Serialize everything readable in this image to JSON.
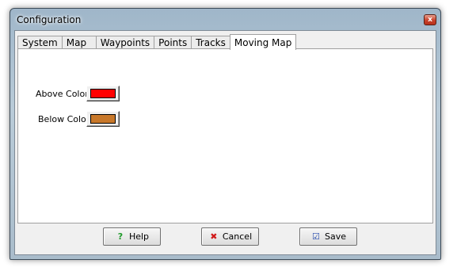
{
  "window": {
    "title": "Configuration",
    "close_label": "x"
  },
  "tabs": [
    {
      "label": "System"
    },
    {
      "label": "Map"
    },
    {
      "label": "Waypoints"
    },
    {
      "label": "Points"
    },
    {
      "label": "Tracks"
    },
    {
      "label": "Moving Map",
      "active": true
    }
  ],
  "moving_map": {
    "above_color_label": "Above Color",
    "above_color_value": "#ff0000",
    "below_color_label": "Below Color",
    "below_color_value": "#c8782a"
  },
  "buttons": {
    "help_label": "Help",
    "help_icon": "question-icon",
    "cancel_label": "Cancel",
    "cancel_icon": "red-x-icon",
    "save_label": "Save",
    "save_icon": "save-check-icon"
  },
  "colors": {
    "help_icon": "#1f9a2a",
    "cancel_icon": "#d11a1a",
    "save_icon": "#2a4fb0"
  }
}
